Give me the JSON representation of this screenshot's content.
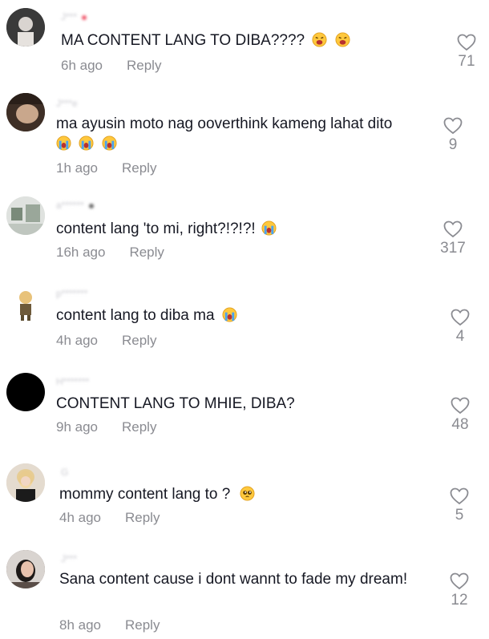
{
  "comments": [
    {
      "username": "J***",
      "text": "MA CONTENT LANG TO DIBA????",
      "emojis": [
        "weary-face",
        "weary-face"
      ],
      "time": "6h ago",
      "reply": "Reply",
      "likes": "71",
      "colors": {
        "verified_dot": "#f05a6e"
      }
    },
    {
      "username": "J***e",
      "text": "ma ayusin moto nag ooverthink kameng lahat dito",
      "emojis": [
        "loudly-crying-face",
        "loudly-crying-face",
        "loudly-crying-face"
      ],
      "time": "1h ago",
      "reply": "Reply",
      "likes": "9"
    },
    {
      "username": "a******",
      "text": "content lang 'to mi, right?!?!?!",
      "emojis": [
        "loudly-crying-face"
      ],
      "time": "16h ago",
      "reply": "Reply",
      "likes": "317"
    },
    {
      "username": "p*******",
      "text": "content lang to diba ma",
      "emojis": [
        "loudly-crying-face"
      ],
      "time": "4h ago",
      "reply": "Reply",
      "likes": "4"
    },
    {
      "username": "H*******",
      "text": "CONTENT LANG TO MHIE, DIBA?",
      "emojis": [],
      "time": "9h ago",
      "reply": "Reply",
      "likes": "48"
    },
    {
      "username": "G",
      "text": "mommy content lang to ?",
      "emojis": [
        "pleading-face"
      ],
      "time": "4h ago",
      "reply": "Reply",
      "likes": "5"
    },
    {
      "username": "J***",
      "text": "Sana content cause i dont wannt to fade my dream!",
      "emojis": [],
      "time": "8h ago",
      "reply": "Reply",
      "likes": "12"
    }
  ],
  "colors": {
    "text": "#161823",
    "muted": "#8a8b91",
    "emoji_yellow": "#ffc83d",
    "tear_blue": "#4aa3f0"
  }
}
